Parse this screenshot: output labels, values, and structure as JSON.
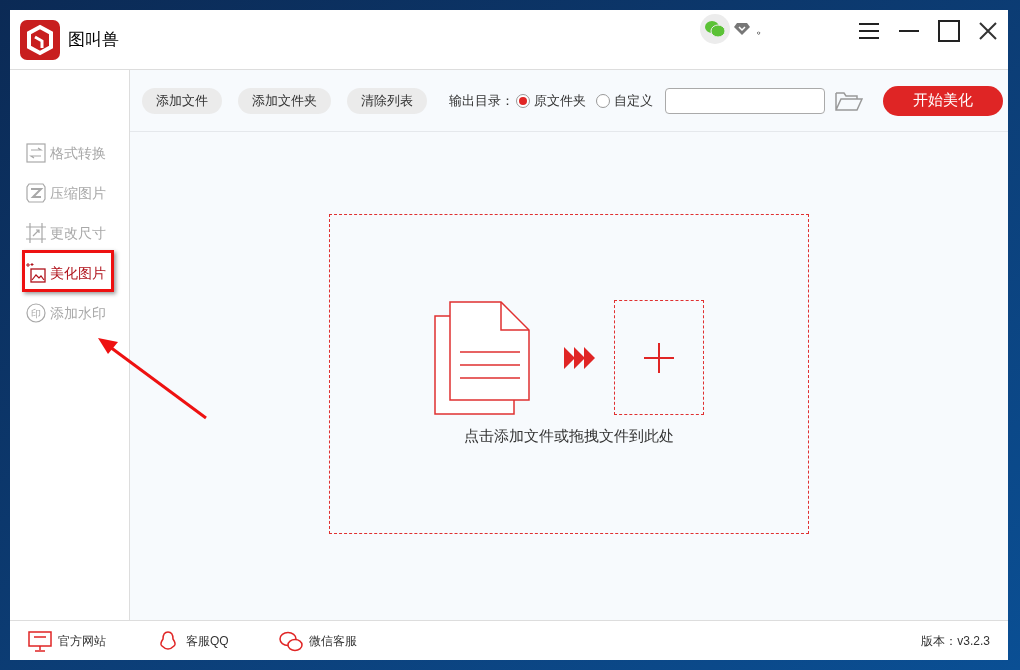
{
  "window": {
    "title": "图叫兽",
    "header_mark": "。"
  },
  "toolbar": {
    "buttons": [
      "添加文件",
      "添加文件夹",
      "清除列表"
    ],
    "output_label": "输出目录：",
    "output_options": [
      {
        "label": "原文件夹",
        "selected": true
      },
      {
        "label": "自定义",
        "selected": false
      }
    ],
    "start_button": "开始美化"
  },
  "sidebar": {
    "items": [
      {
        "kind": "convert",
        "label": "格式转换",
        "selected": false
      },
      {
        "kind": "compress",
        "label": "压缩图片",
        "selected": false
      },
      {
        "kind": "resize",
        "label": "更改尺寸",
        "selected": false
      },
      {
        "kind": "beautify",
        "label": "美化图片",
        "selected": true
      },
      {
        "kind": "watermark",
        "icon_glyph": "印",
        "label": "添加水印",
        "selected": false
      }
    ]
  },
  "drop_zone": {
    "hint": "点击添加文件或拖拽文件到此处"
  },
  "status_bar": {
    "links": [
      {
        "kind": "website",
        "label": "官方网站"
      },
      {
        "kind": "qq",
        "label": "客服QQ"
      },
      {
        "kind": "wechat",
        "label": "微信客服"
      }
    ],
    "version": "版本：v3.2.3"
  }
}
